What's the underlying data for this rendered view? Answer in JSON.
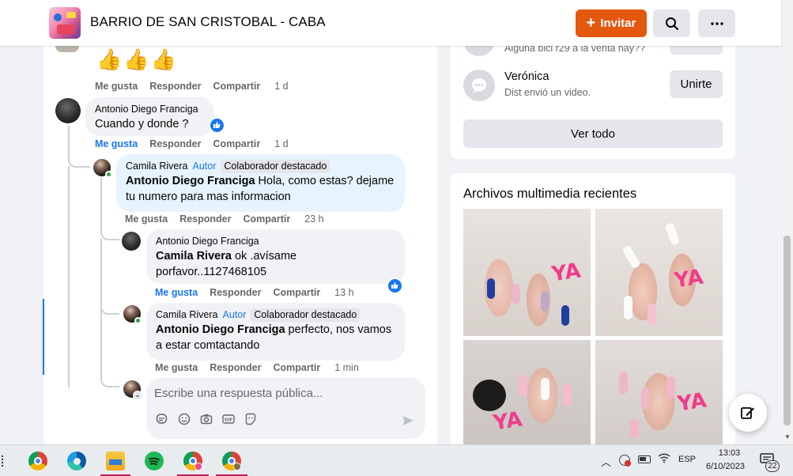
{
  "header": {
    "title": "BARRIO DE SAN CRISTOBAL - CABA",
    "invite_label": "Invitar"
  },
  "feed": {
    "top_actions": {
      "like": "Me gusta",
      "reply": "Responder",
      "share": "Compartir",
      "time": "1 d"
    },
    "comments": [
      {
        "author": "Antonio Diego Franciga",
        "text": "Cuando y donde ?",
        "actions": {
          "like": "Me gusta",
          "reply": "Responder",
          "share": "Compartir",
          "time": "1 d"
        }
      },
      {
        "author": "Camila Rivera",
        "role": "Autor",
        "badge": "Colaborador destacado",
        "mention": "Antonio Diego Franciga",
        "text": " Hola, como estas? dejame tu numero para mas informacion",
        "actions": {
          "like": "Me gusta",
          "reply": "Responder",
          "share": "Compartir",
          "time": "23 h"
        }
      },
      {
        "author": "Antonio Diego Franciga",
        "mention": "Camila Rivera",
        "text": " ok .avísame porfavor..1127468105",
        "actions": {
          "like": "Me gusta",
          "reply": "Responder",
          "share": "Compartir",
          "time": "13 h"
        }
      },
      {
        "author": "Camila Rivera",
        "role": "Autor",
        "badge": "Colaborador destacado",
        "mention": "Antonio Diego Franciga",
        "text": " perfecto, nos vamos a estar comtactando",
        "actions": {
          "like": "Me gusta",
          "reply": "Responder",
          "share": "Compartir",
          "time": "1 min"
        }
      }
    ],
    "reply_placeholder": "Escribe una respuesta pública..."
  },
  "sidebar": {
    "chat_partial_sub": "Alguna bici r29 a la venta hay??",
    "chat": {
      "name": "Verónica",
      "sub": "Dist envió un video.",
      "join_label": "Unirte"
    },
    "see_all_label": "Ver todo",
    "media_heading": "Archivos multimedia recientes",
    "media_watermark": "YA"
  },
  "taskbar": {
    "lang": "ESP",
    "time": "13:03",
    "date": "6/10/2023",
    "notif_count": "22"
  }
}
